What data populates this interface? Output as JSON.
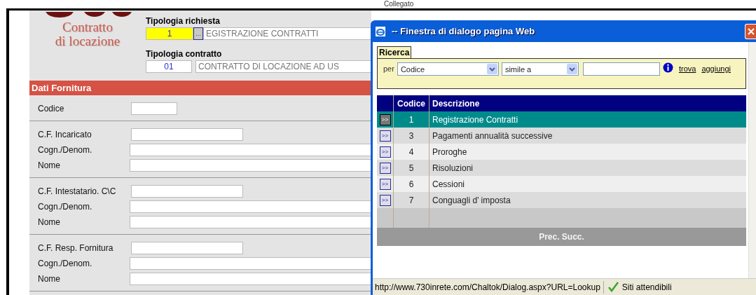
{
  "page": {
    "logo": {
      "line_1": "Contratto",
      "line_2": "di locazione"
    },
    "top_label": "Collegato",
    "tipologia_richiesta": {
      "label": "Tipologia richiesta",
      "code": "1",
      "button": "...",
      "description": "EGISTRAZIONE CONTRATTI"
    },
    "tipologia_contratto": {
      "label": "Tipologia contratto",
      "code": "01",
      "description": "CONTRATTO DI LOCAZIONE AD US"
    },
    "section": {
      "title": "Dati Fornitura",
      "groups": [
        {
          "fields": [
            {
              "label": "Codice",
              "kind": "short"
            }
          ]
        },
        {
          "fields": [
            {
              "label": "C.F. Incaricato",
              "kind": "medium"
            },
            {
              "label": "Cogn./Denom.",
              "kind": "long"
            },
            {
              "label": "Nome",
              "kind": "long"
            }
          ]
        },
        {
          "fields": [
            {
              "label": "C.F. Intestatario. C\\C",
              "kind": "medium"
            },
            {
              "label": "Cogn./Denom.",
              "kind": "long"
            },
            {
              "label": "Nome",
              "kind": "long"
            }
          ]
        },
        {
          "fields": [
            {
              "label": "C.F. Resp. Fornitura",
              "kind": "medium"
            },
            {
              "label": "Cogn./Denom.",
              "kind": "long"
            },
            {
              "label": "Nome",
              "kind": "long"
            }
          ]
        }
      ]
    }
  },
  "dialog": {
    "title": "-- Finestra di dialogo pagina Web",
    "tab": "Ricerca",
    "per_label": "per",
    "field_select": "Codice",
    "operator_select": "simile a",
    "links": [
      "trova",
      "aggiungi"
    ],
    "table": {
      "columns": [
        "Codice",
        "Descrizione"
      ],
      "rows": [
        {
          "button": ">>",
          "code": "1",
          "description": "Registrazione Contratti",
          "selected": true
        },
        {
          "button": ">>",
          "code": "3",
          "description": "Pagamenti annualità successive",
          "selected": false
        },
        {
          "button": ">>",
          "code": "4",
          "description": "Proroghe",
          "selected": false
        },
        {
          "button": ">>",
          "code": "5",
          "description": "Risoluzioni",
          "selected": false
        },
        {
          "button": ">>",
          "code": "6",
          "description": "Cessioni",
          "selected": false
        },
        {
          "button": ">>",
          "code": "7",
          "description": "Conguagli d’ imposta",
          "selected": false
        }
      ]
    },
    "pager": "Prec. Succ.",
    "status": {
      "url": "http://www.730inrete.com/Chaltok/Dialog.aspx?URL=Lookup",
      "zone": "Siti attendibili"
    }
  }
}
